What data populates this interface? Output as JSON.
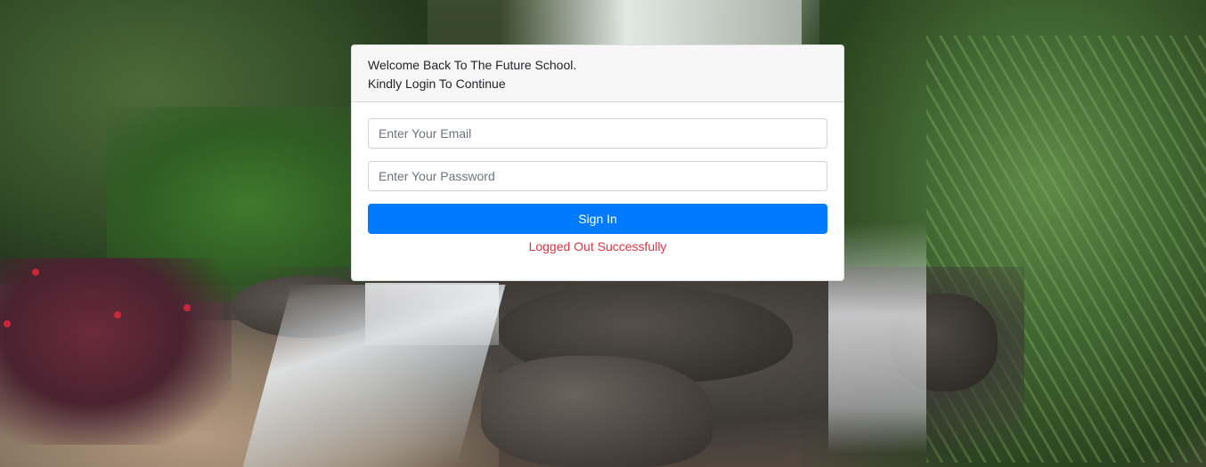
{
  "login": {
    "welcome_line": "Welcome Back To The Future School.",
    "instruction_line": "Kindly Login To Continue",
    "email_placeholder": "Enter Your Email",
    "email_value": "",
    "password_placeholder": "Enter Your Password",
    "password_value": "",
    "signin_label": "Sign In",
    "status_message": "Logged Out Successfully"
  },
  "colors": {
    "primary_button": "#007bff",
    "status_error": "#dc3545",
    "card_header_bg": "#f7f7f7"
  }
}
